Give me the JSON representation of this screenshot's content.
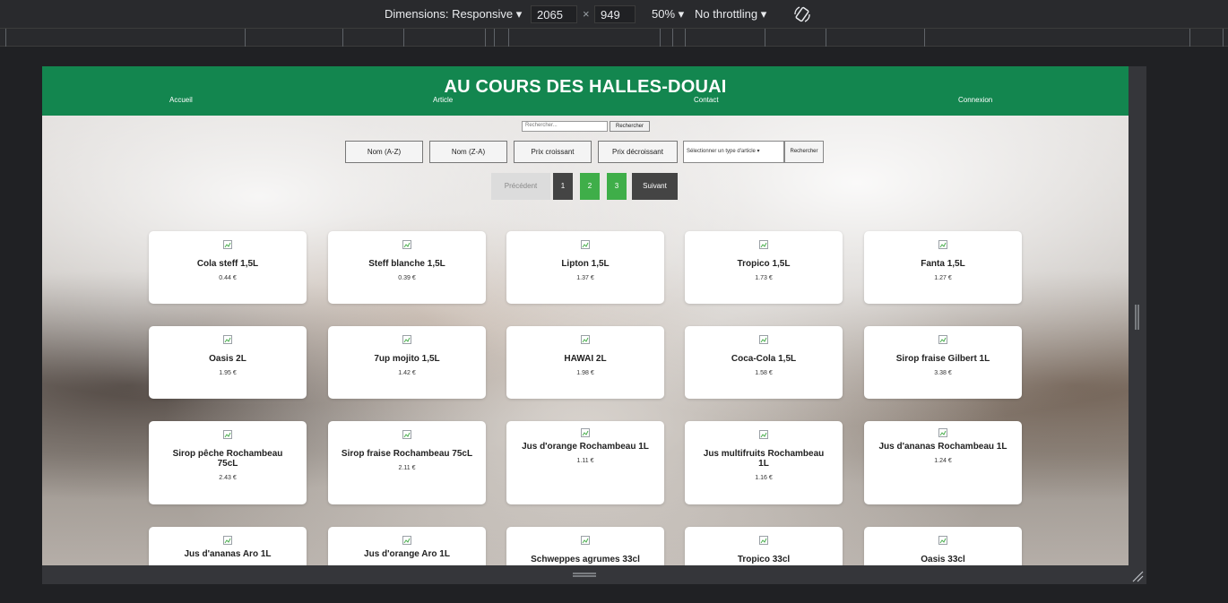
{
  "devtools": {
    "dimensions_label": "Dimensions: Responsive",
    "width": "2065",
    "times": "×",
    "height": "949",
    "zoom": "50%",
    "throttling": "No throttling"
  },
  "site": {
    "title": "AU COURS DES HALLES-DOUAI",
    "nav": [
      "Accueil",
      "Article",
      "Contact",
      "Connexion"
    ],
    "search_placeholder": "Rechercher...",
    "search_button": "Rechercher",
    "sort_buttons": [
      "Nom (A-Z)",
      "Nom (Z-A)",
      "Prix croissant",
      "Prix décroissant"
    ],
    "type_select": "Sélectionner un type d'article",
    "type_button": "Rechercher",
    "pagination": {
      "prev": "Précédent",
      "pages": [
        "1",
        "2",
        "3"
      ],
      "next": "Suivant"
    },
    "colors": {
      "header": "#13864f",
      "page_active": "#444444",
      "page": "#3fae49"
    }
  },
  "products": [
    {
      "name": "Cola steff 1,5L",
      "price": "0.44 €"
    },
    {
      "name": "Steff blanche 1,5L",
      "price": "0.39 €"
    },
    {
      "name": "Lipton 1,5L",
      "price": "1.37 €"
    },
    {
      "name": "Tropico 1,5L",
      "price": "1.73 €"
    },
    {
      "name": "Fanta 1,5L",
      "price": "1.27 €"
    },
    {
      "name": "Oasis 2L",
      "price": "1.95 €"
    },
    {
      "name": "7up mojito 1,5L",
      "price": "1.42 €"
    },
    {
      "name": "HAWAI 2L",
      "price": "1.98 €"
    },
    {
      "name": "Coca-Cola 1,5L",
      "price": "1.58 €"
    },
    {
      "name": "Sirop fraise Gilbert 1L",
      "price": "3.38 €"
    },
    {
      "name": "Sirop pêche Rochambeau 75cL",
      "price": "2.43 €"
    },
    {
      "name": "Sirop fraise Rochambeau 75cL",
      "price": "2.11 €"
    },
    {
      "name": "Jus d'orange Rochambeau 1L",
      "price": "1.11 €"
    },
    {
      "name": "Jus multifruits Rochambeau 1L",
      "price": "1.16 €"
    },
    {
      "name": "Jus d'ananas Rochambeau 1L",
      "price": "1.24 €"
    },
    {
      "name": "Jus d'ananas Aro 1L",
      "price": ""
    },
    {
      "name": "Jus d'orange Aro 1L",
      "price": ""
    },
    {
      "name": "Schweppes agrumes 33cl",
      "price": ""
    },
    {
      "name": "Tropico 33cl",
      "price": ""
    },
    {
      "name": "Oasis 33cl",
      "price": ""
    }
  ]
}
